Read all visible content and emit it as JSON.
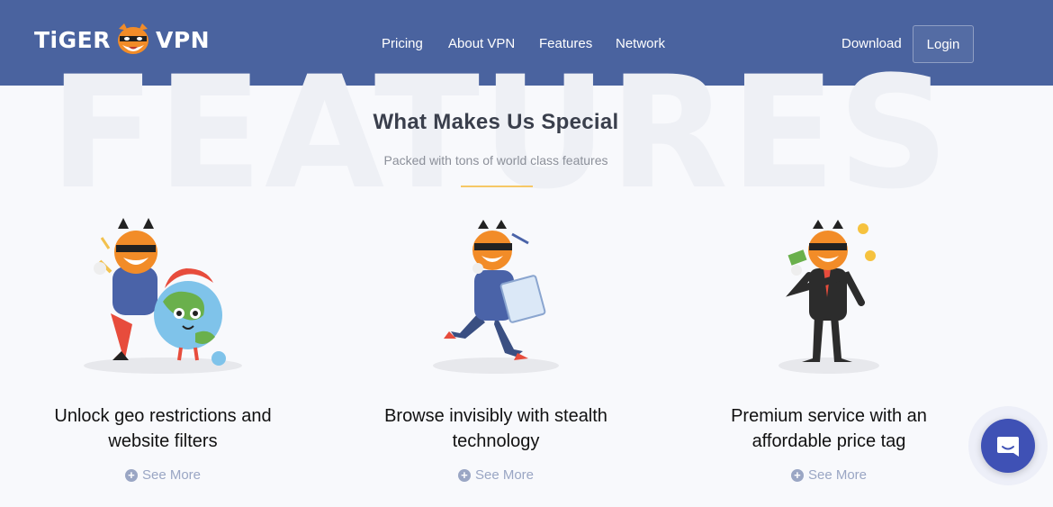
{
  "brand": {
    "name_left": "TiGER",
    "name_right": "VPN"
  },
  "nav": {
    "items": [
      {
        "label": "Pricing"
      },
      {
        "label": "About VPN"
      },
      {
        "label": "Features"
      },
      {
        "label": "Network"
      }
    ],
    "download": "Download",
    "login": "Login"
  },
  "hero": {
    "watermark": "FEATURES",
    "title": "What Makes Us Special",
    "subtitle": "Packed with tons of world class features"
  },
  "features": [
    {
      "title_line1": "Unlock geo restrictions and",
      "title_line2": "website filters",
      "link": "See More"
    },
    {
      "title_line1": "Browse invisibly with stealth",
      "title_line2": "technology",
      "link": "See More"
    },
    {
      "title_line1": "Premium service with an",
      "title_line2": "affordable price tag",
      "link": "See More"
    }
  ],
  "colors": {
    "header_bg": "#4a639f",
    "accent": "#f6c866",
    "link": "#9aa6c4",
    "chat": "#3f51b5"
  },
  "icons": {
    "chat": "chat-bubble-icon",
    "plus": "plus-circle-icon"
  }
}
